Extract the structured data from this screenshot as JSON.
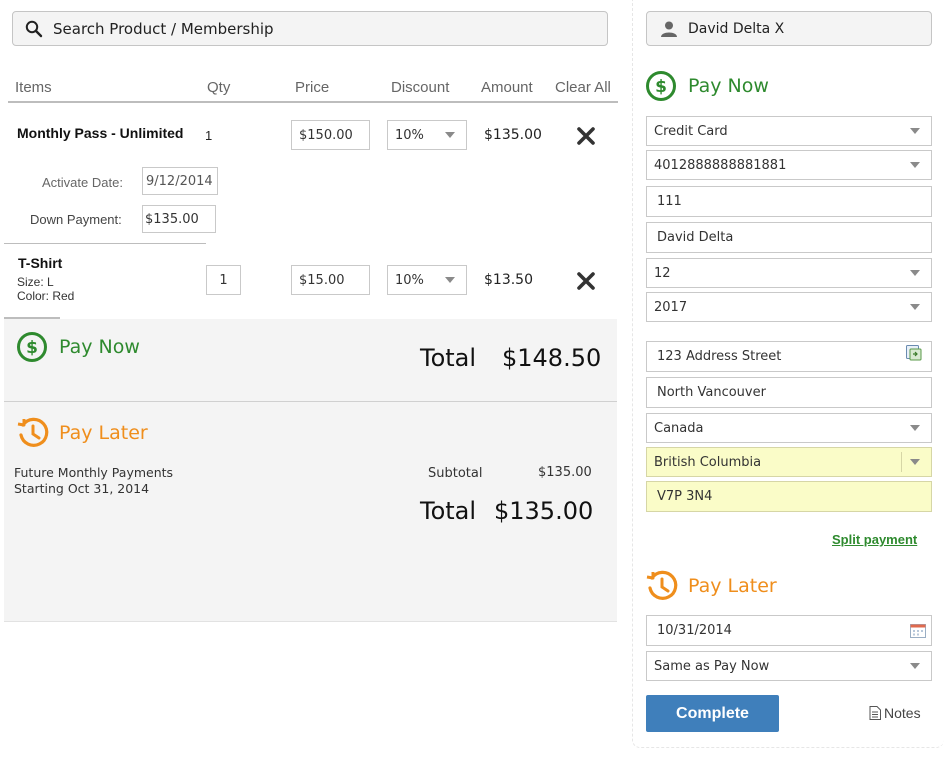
{
  "search": {
    "placeholder": "Search Product / Membership"
  },
  "customer": {
    "name": "David Delta X"
  },
  "table": {
    "headers": {
      "items": "Items",
      "qty": "Qty",
      "price": "Price",
      "discount": "Discount",
      "amount": "Amount",
      "clear_all": "Clear All"
    },
    "rows": [
      {
        "name": "Monthly Pass - Unlimited",
        "qty": "1",
        "price": "$150.00",
        "discount": "10%",
        "amount": "$135.00",
        "activate_label": "Activate Date:",
        "activate_value": "9/12/2014",
        "down_label": "Down Payment:",
        "down_value": "$135.00"
      },
      {
        "name": "T-Shirt",
        "size": "Size: L",
        "color": "Color: Red",
        "qty": "1",
        "price": "$15.00",
        "discount": "10%",
        "amount": "$13.50"
      }
    ]
  },
  "summary": {
    "pay_now_title": "Pay Now",
    "pay_now_total_label": "Total",
    "pay_now_total_value": "$148.50",
    "pay_later_title": "Pay Later",
    "future_line1": "Future Monthly Payments",
    "future_line2": "Starting Oct 31, 2014",
    "subtotal_label": "Subtotal",
    "subtotal_value": "$135.00",
    "pay_later_total_label": "Total",
    "pay_later_total_value": "$135.00"
  },
  "payment": {
    "pay_now_title": "Pay Now",
    "method": "Credit Card",
    "card_number": "4012888888881881",
    "cvv": "111",
    "cardholder": "David Delta",
    "exp_month": "12",
    "exp_year": "2017",
    "address": "123 Address Street",
    "city": "North Vancouver",
    "country": "Canada",
    "province": "British Columbia",
    "postal": "V7P 3N4",
    "split_payment": "Split payment",
    "pay_later_title": "Pay Later",
    "pay_later_date": "10/31/2014",
    "pay_later_method": "Same as Pay Now",
    "complete": "Complete",
    "notes": "Notes"
  },
  "colors": {
    "green": "#2e8a2e",
    "orange": "#ef8e1c",
    "button_blue": "#3f7fbb",
    "highlight": "#fafcc8"
  }
}
